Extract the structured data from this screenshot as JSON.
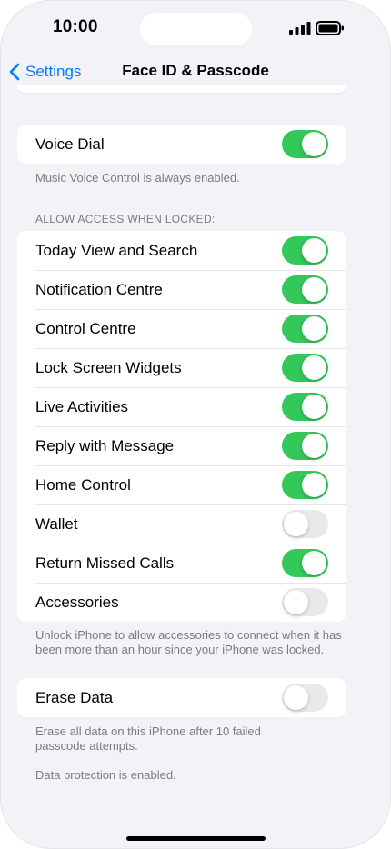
{
  "status": {
    "time": "10:00",
    "icons": [
      "signal-icon",
      "battery-icon"
    ]
  },
  "nav": {
    "back_label": "Settings",
    "title": "Face ID & Passcode"
  },
  "voice_dial": {
    "label": "Voice Dial",
    "on": true,
    "footnote": "Music Voice Control is always enabled."
  },
  "locked_access": {
    "header": "ALLOW ACCESS WHEN LOCKED:",
    "items": [
      {
        "label": "Today View and Search",
        "on": true
      },
      {
        "label": "Notification Centre",
        "on": true
      },
      {
        "label": "Control Centre",
        "on": true
      },
      {
        "label": "Lock Screen Widgets",
        "on": true
      },
      {
        "label": "Live Activities",
        "on": true
      },
      {
        "label": "Reply with Message",
        "on": true
      },
      {
        "label": "Home Control",
        "on": true
      },
      {
        "label": "Wallet",
        "on": false
      },
      {
        "label": "Return Missed Calls",
        "on": true
      },
      {
        "label": "Accessories",
        "on": false
      }
    ],
    "footnote": "Unlock iPhone to allow accessories to connect when it has been more than an hour since your iPhone was locked."
  },
  "erase_data": {
    "label": "Erase Data",
    "on": false,
    "footnote_1": "Erase all data on this iPhone after 10 failed passcode attempts.",
    "footnote_2": "Data protection is enabled."
  },
  "colors": {
    "accent": "#007aff",
    "toggle_on": "#34c759",
    "toggle_off": "#e9e9eb",
    "background": "#f2f2f7"
  }
}
